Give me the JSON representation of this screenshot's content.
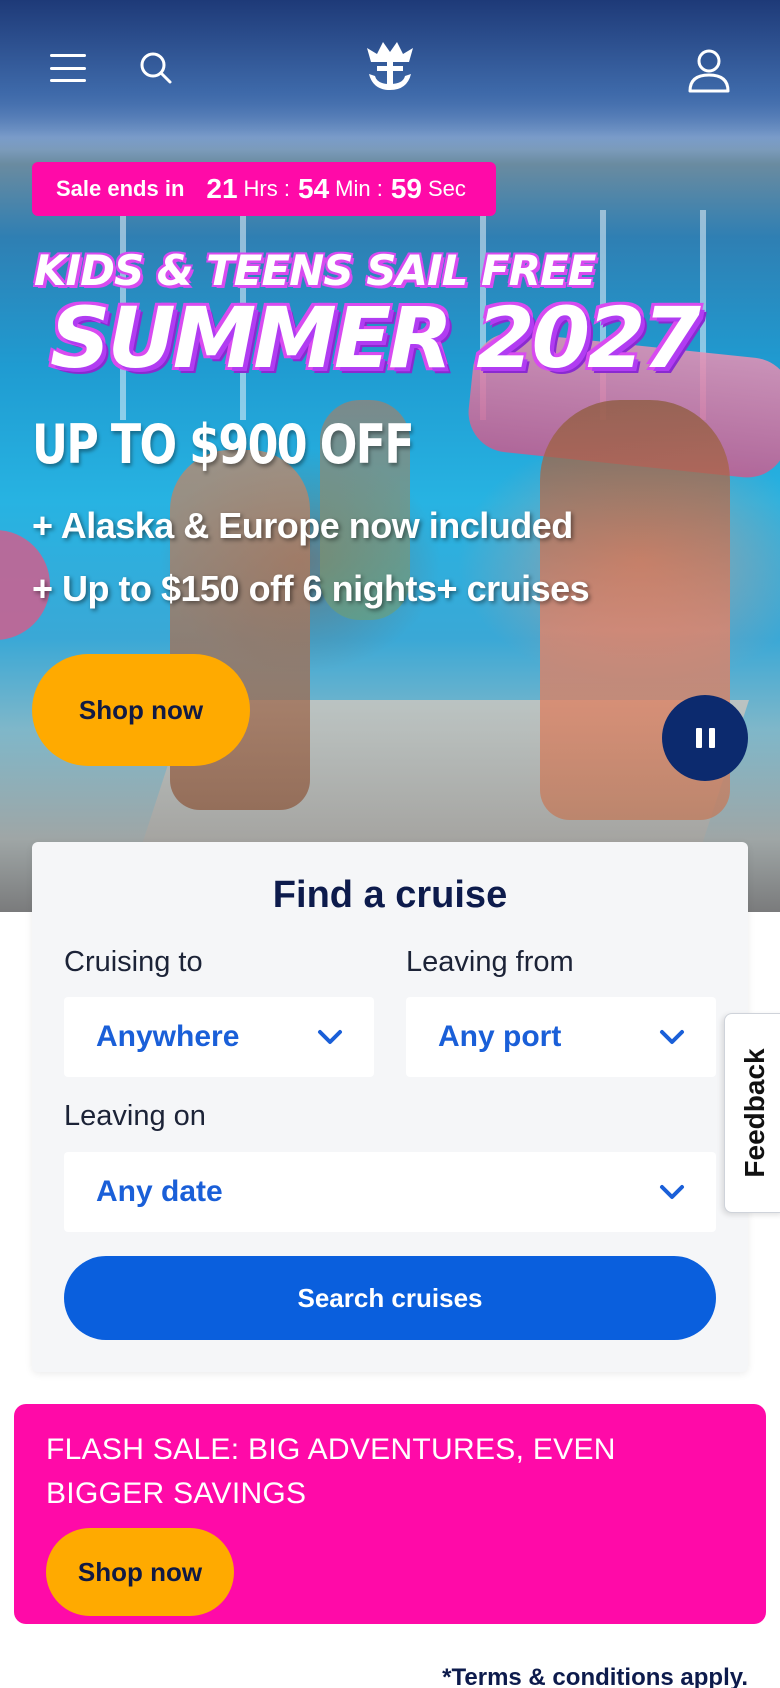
{
  "nav": {
    "menu_icon": "hamburger-menu-icon",
    "search_icon": "search-icon",
    "logo_icon": "crown-anchor-logo-icon",
    "account_icon": "user-account-icon"
  },
  "countdown": {
    "label": "Sale ends in",
    "hours": "21",
    "hours_unit": "Hrs :",
    "minutes": "54",
    "minutes_unit": "Min :",
    "seconds": "59",
    "seconds_unit": "Sec"
  },
  "hero": {
    "headline_small": "KIDS & TEENS SAIL FREE",
    "headline_big": "SUMMER 2027",
    "offer": "UP TO $900 OFF",
    "line1": "+ Alaska & Europe now included",
    "line2": "+ Up to $150 off 6 nights+ cruises",
    "cta": "Shop now",
    "pause_icon": "pause-icon"
  },
  "finder": {
    "title": "Find a cruise",
    "cruising_to_label": "Cruising to",
    "cruising_to_value": "Anywhere",
    "leaving_from_label": "Leaving from",
    "leaving_from_value": "Any port",
    "leaving_on_label": "Leaving on",
    "leaving_on_value": "Any date",
    "search_button": "Search cruises"
  },
  "feedback": {
    "label": "Feedback"
  },
  "flash": {
    "title": "FLASH SALE: BIG ADVENTURES, EVEN BIGGER SAVINGS",
    "cta": "Shop now"
  },
  "terms": "*Terms & conditions apply.",
  "colors": {
    "pink": "#ff0aa8",
    "yellow": "#ffaa00",
    "blue": "#0a5fdd",
    "navy": "#0d1b4c"
  }
}
